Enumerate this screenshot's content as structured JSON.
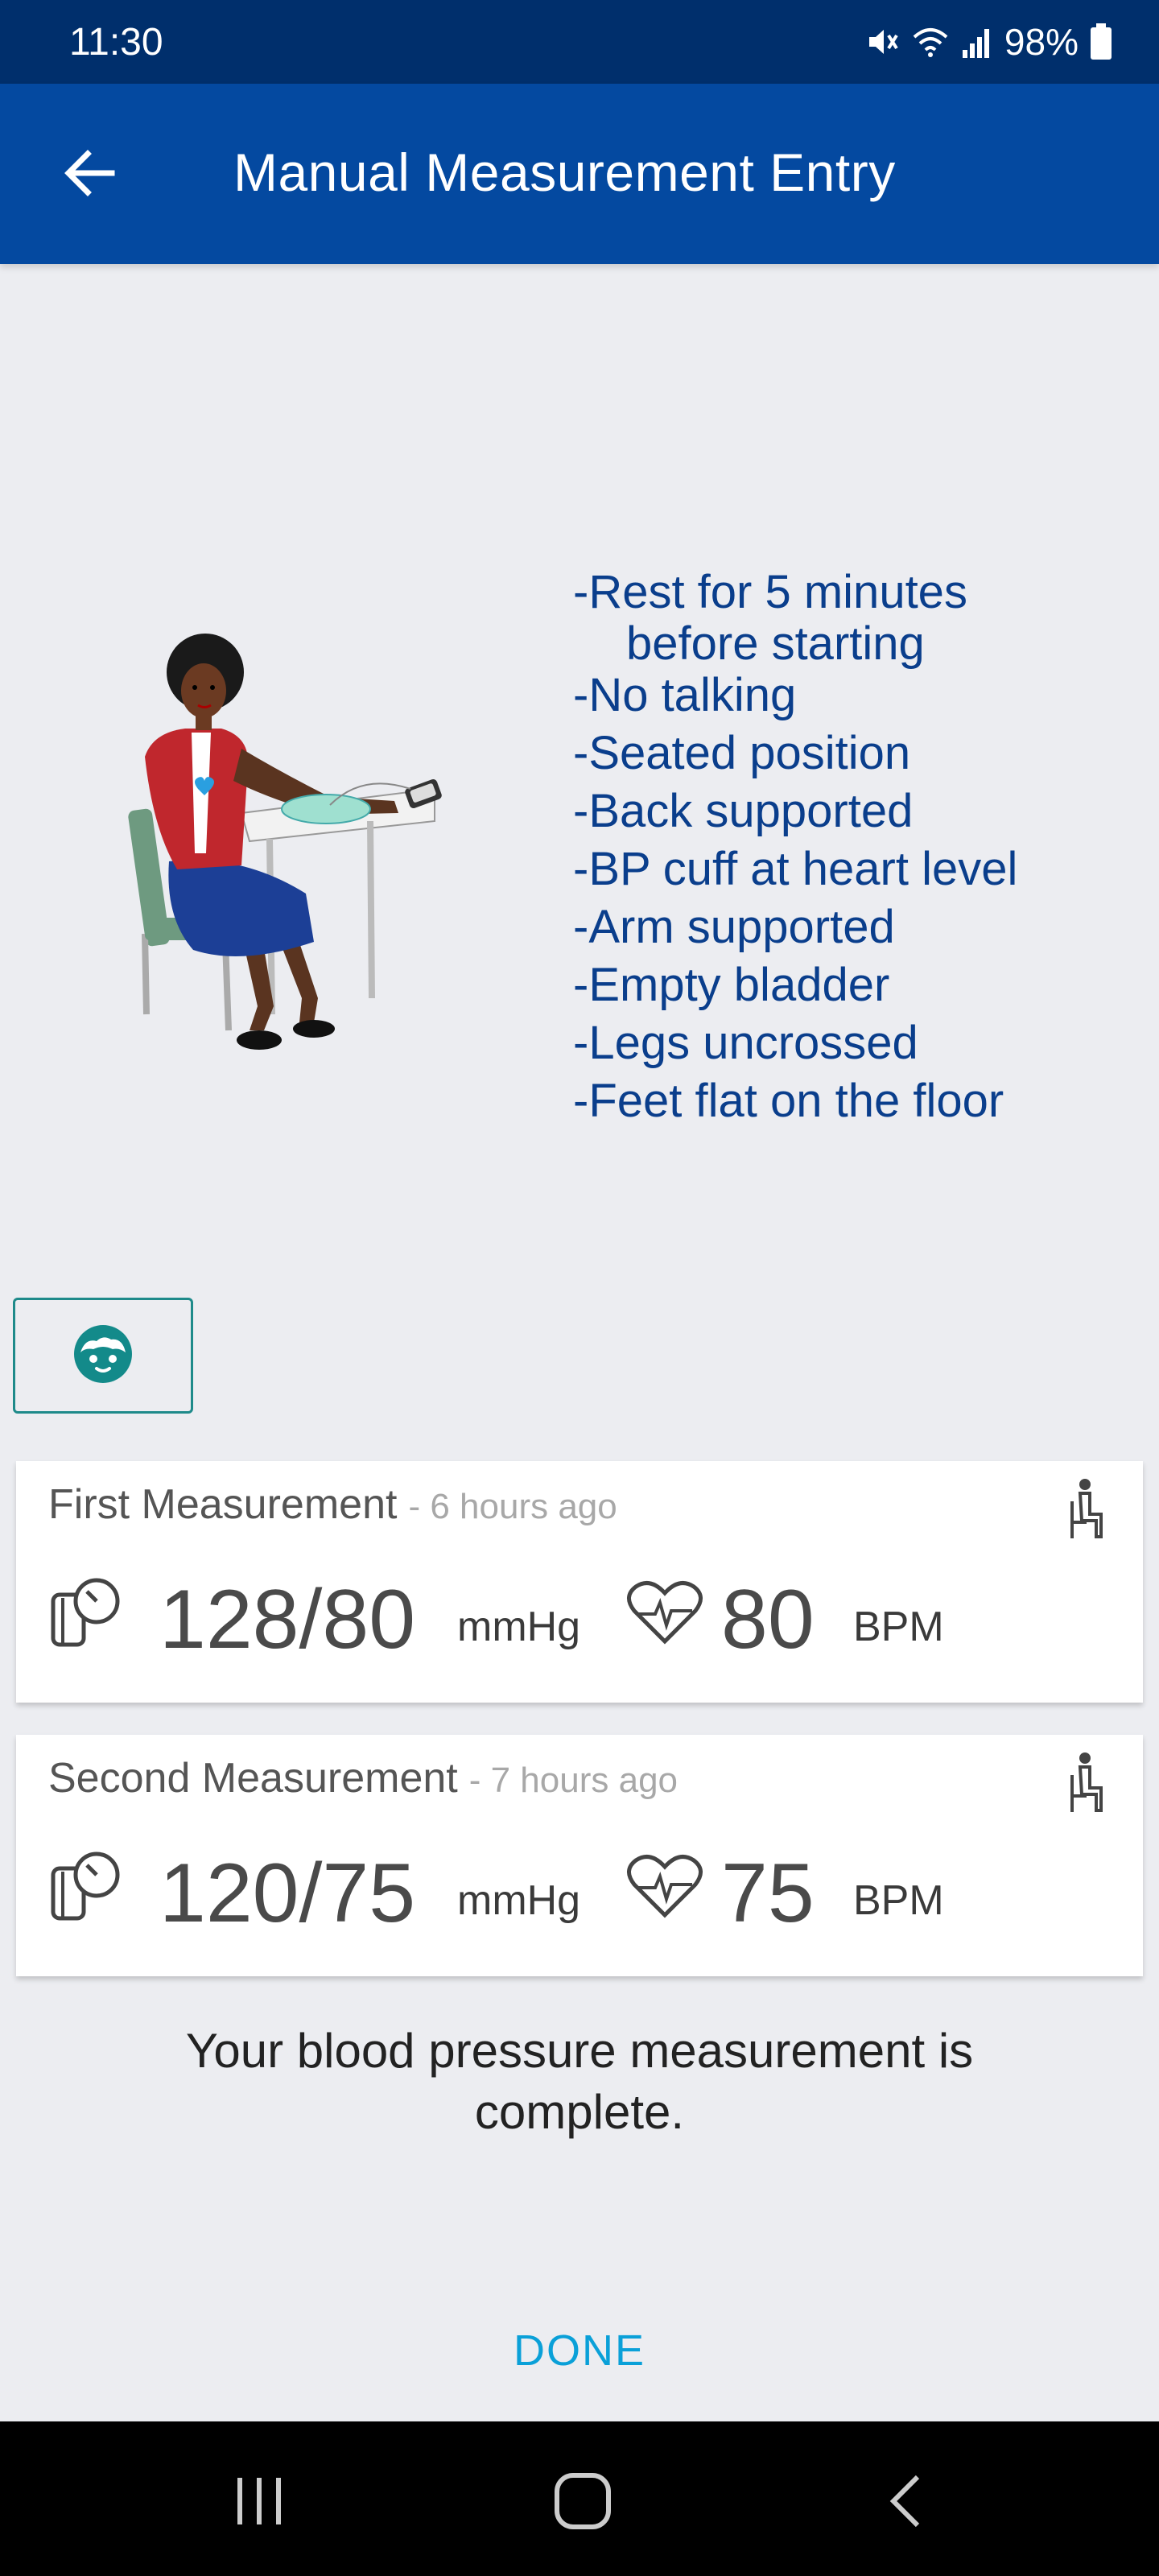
{
  "status_bar": {
    "time": "11:30",
    "battery": "98%",
    "icons": [
      "mute-icon",
      "wifi-icon",
      "signal-icon",
      "battery-icon"
    ]
  },
  "app_bar": {
    "title": "Manual Measurement Entry",
    "back_icon": "arrow-left-icon"
  },
  "instructions": {
    "rest_line1": "-Rest for 5 minutes",
    "rest_line2": "before starting",
    "items": [
      "-No talking",
      "-Seated position",
      "-Back supported",
      "-BP cuff at heart level",
      "-Arm supported",
      "-Empty bladder",
      "-Legs uncrossed",
      "-Feet flat on the floor"
    ]
  },
  "avatar_button": {
    "icon": "face-icon"
  },
  "measurements": [
    {
      "title": "First Measurement",
      "time": "- 6 hours ago",
      "bp": "128/80",
      "bp_unit": "mmHg",
      "pulse": "80",
      "pulse_unit": "BPM"
    },
    {
      "title": "Second Measurement",
      "time": "- 7 hours ago",
      "bp": "120/75",
      "bp_unit": "mmHg",
      "pulse": "75",
      "pulse_unit": "BPM"
    }
  ],
  "completion": {
    "line1": "Your blood pressure measurement is",
    "line2": "complete."
  },
  "done_label": "DONE",
  "colors": {
    "status_bar": "#002f6c",
    "app_bar": "#0449a0",
    "instruction_text": "#0a3e8c",
    "accent_teal": "#1e8a8a",
    "done": "#0aa0d8",
    "background": "#ecedf1"
  }
}
